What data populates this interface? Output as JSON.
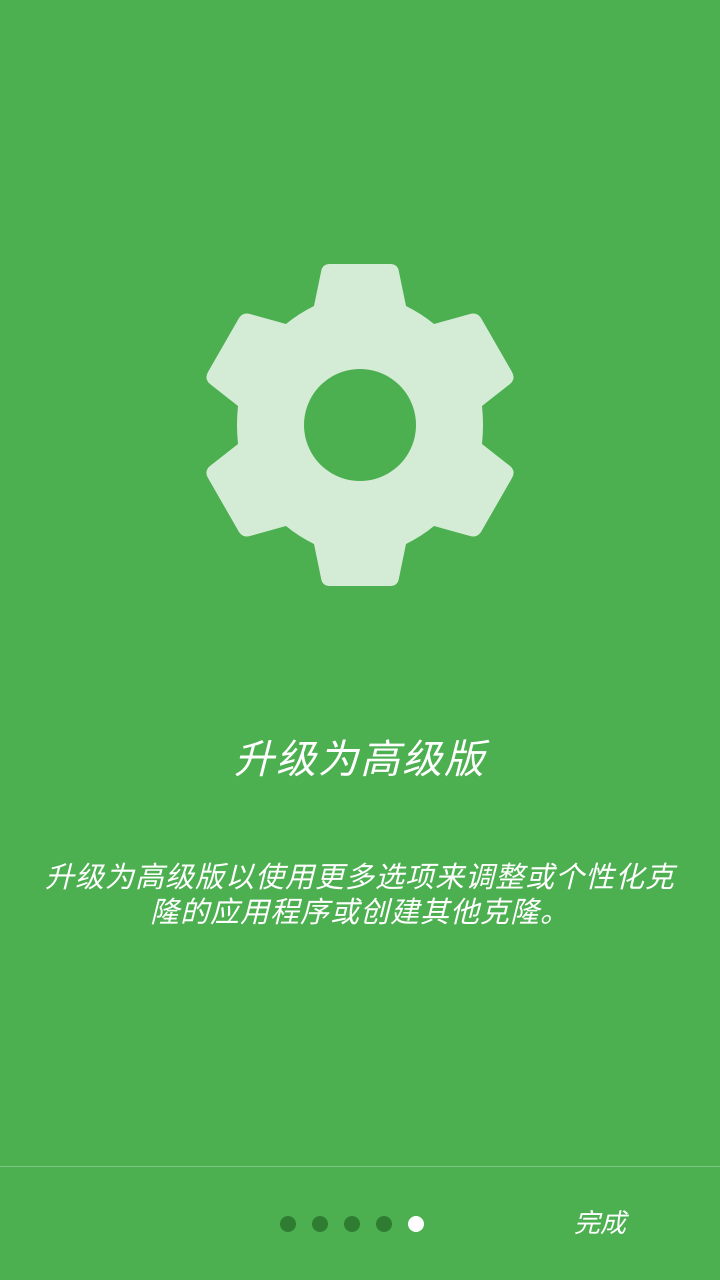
{
  "screen": {
    "background_color": "#4caf50",
    "icon": "gear-icon",
    "icon_color": "#d4ecd6",
    "title": "升级为高级版",
    "description": "升级为高级版以使用更多选项来调整或个性化克隆的应用程序或创建其他克隆。"
  },
  "pager": {
    "total_pages": 5,
    "current_page": 5,
    "inactive_color": "#2e7d32",
    "active_color": "#ffffff"
  },
  "footer": {
    "done_label": "完成"
  }
}
